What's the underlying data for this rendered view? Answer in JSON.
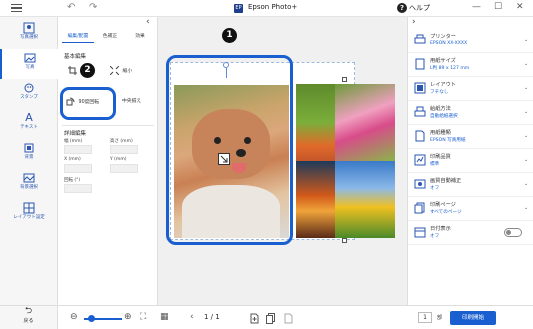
{
  "titlebar": {
    "app_title": "Epson Photo+",
    "app_logo": "EP",
    "help_label": "ヘルプ",
    "help_glyph": "?",
    "undo_glyph": "↶",
    "redo_glyph": "↷",
    "minimize_glyph": "—",
    "maximize_glyph": "☐",
    "close_glyph": "✕"
  },
  "rail": {
    "items": [
      {
        "label": "写真選択",
        "icon": "photo-select-icon"
      },
      {
        "label": "写真",
        "icon": "photo-icon"
      },
      {
        "label": "スタンプ",
        "icon": "stamp-icon"
      },
      {
        "label": "テキスト",
        "icon": "text-icon"
      },
      {
        "label": "背景",
        "icon": "background-icon"
      },
      {
        "label": "背景選択",
        "icon": "background-select-icon"
      },
      {
        "label": "レイアウト設定",
        "icon": "layout-settings-icon"
      }
    ],
    "text_glyph": "A"
  },
  "side_panel": {
    "collapse_glyph": "‹",
    "tabs": [
      "編集/配置",
      "色補正",
      "効果"
    ],
    "section_basic": "基本編集",
    "tool_rotate": "90度回転",
    "tool_center": "中央揃え",
    "tool_shrink": "縮小",
    "section_detail": "詳細編集",
    "width_label": "幅 (mm)",
    "height_label": "高さ (mm)",
    "x_label": "X (mm)",
    "y_label": "Y (mm)",
    "rotation_label": "回転 (°)"
  },
  "canvas": {
    "callout_1": "1",
    "callout_2": "2"
  },
  "settings": {
    "expand_glyph": "›",
    "chevron_glyph": "⌄",
    "rows": [
      {
        "title": "プリンター",
        "value": "EPSON XX-XXXX",
        "icon": "printer-icon"
      },
      {
        "title": "用紙サイズ",
        "value": "L判 89 x 127 mm",
        "icon": "paper-size-icon"
      },
      {
        "title": "レイアウト",
        "value": "フチなし",
        "icon": "layout-icon"
      },
      {
        "title": "給紙方法",
        "value": "自動給紙選択",
        "icon": "paper-feed-icon"
      },
      {
        "title": "用紙種類",
        "value": "EPSON 写真用紙",
        "icon": "paper-type-icon"
      },
      {
        "title": "印刷品質",
        "value": "標準",
        "icon": "print-quality-icon"
      },
      {
        "title": "画質自動補正",
        "value": "オフ",
        "icon": "auto-correct-icon"
      },
      {
        "title": "印刷ページ",
        "value": "すべてのページ",
        "icon": "print-pages-icon"
      }
    ],
    "date_print_title": "日付表示",
    "date_print_value": "オフ"
  },
  "bottombar": {
    "back_label": "戻る",
    "back_glyph": "⮌",
    "zoom_out_glyph": "⊖",
    "zoom_in_glyph": "⊕",
    "zoom_level": 0.2,
    "fit_glyph": "⛶",
    "grid_glyph": "▦",
    "prev_glyph": "‹",
    "next_glyph": "›",
    "page_indicator": "1 / 1",
    "copies": "1",
    "copies_label": "部",
    "print_label": "印刷開始"
  },
  "colors": {
    "accent": "#1a5fd0",
    "callout": "#111111"
  }
}
